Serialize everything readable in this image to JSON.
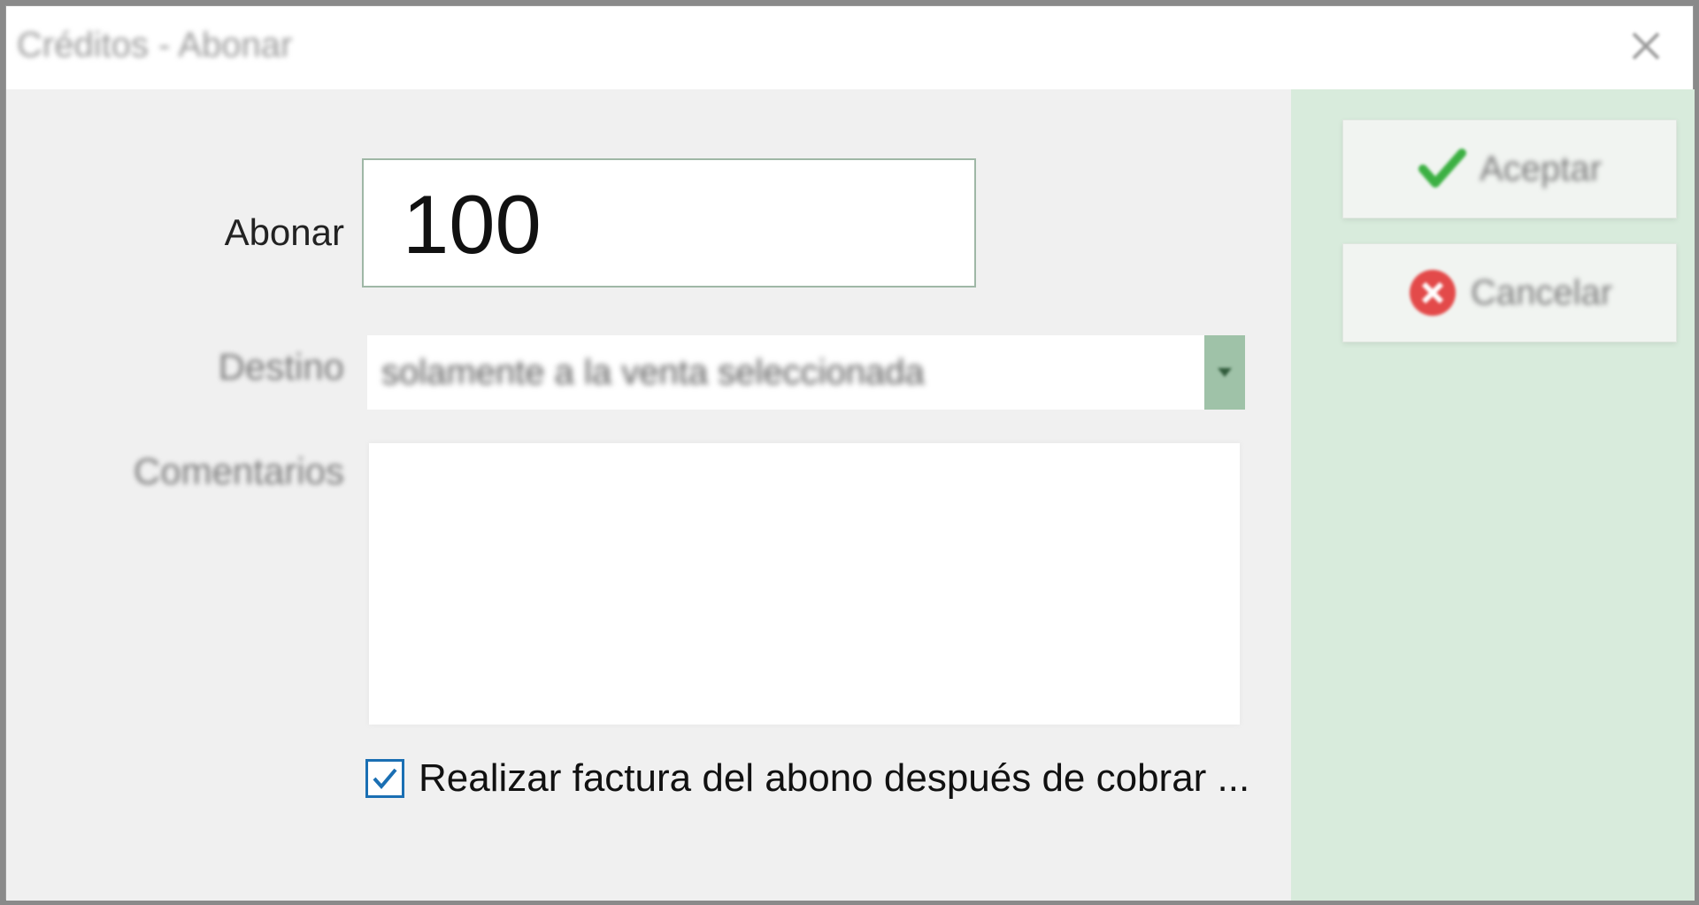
{
  "window": {
    "title": "Créditos - Abonar"
  },
  "form": {
    "amount_label": "Abonar",
    "amount_value": "100",
    "destination_label": "Destino",
    "destination_value": "solamente a la venta seleccionada",
    "comments_label": "Comentarios",
    "comments_value": "",
    "invoice_checkbox_label": "Realizar factura del abono después de cobrar ...",
    "invoice_checked": true
  },
  "buttons": {
    "accept_label": "Aceptar",
    "cancel_label": "Cancelar"
  },
  "colors": {
    "side_panel": "#d8ebdc",
    "accept_icon": "#3cb043",
    "cancel_icon": "#e34a4a",
    "checkbox_border": "#1a6fb3"
  },
  "icons": {
    "close": "close-icon",
    "dropdown": "chevron-down-icon",
    "accept": "checkmark-icon",
    "cancel": "cancel-circle-icon",
    "checkbox": "checkmark-icon"
  }
}
